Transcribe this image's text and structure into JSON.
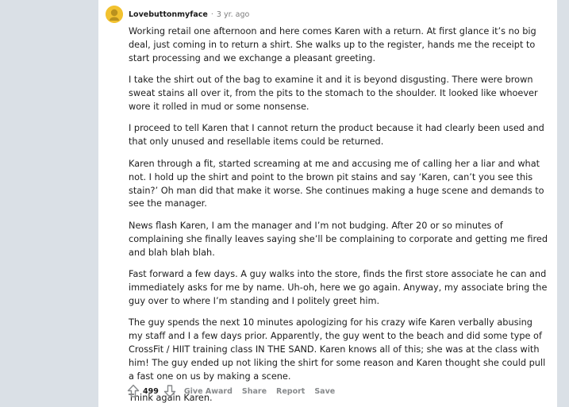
{
  "comment": {
    "username": "Lovebuttonmyface",
    "separator": "·",
    "time_ago": "3 yr. ago",
    "paragraphs": [
      "Working retail one afternoon and here comes Karen with a return. At first glance it’s no big deal, just coming in to return a shirt. She walks up to the register, hands me the receipt to start processing and we exchange a pleasant greeting.",
      "I take the shirt out of the bag to examine it and it is beyond disgusting. There were brown sweat stains all over it, from the pits to the stomach to the shoulder. It looked like whoever wore it rolled in mud or some nonsense.",
      "I proceed to tell Karen that I cannot return the product because it had clearly been used and that only unused and resellable items could be returned.",
      "Karen through a fit, started screaming at me and accusing me of calling her a liar and what not. I hold up the shirt and point to the brown pit stains and say ‘Karen, can’t you see this stain?’ Oh man did that make it worse. She continues making a huge scene and demands to see the manager.",
      "News flash Karen, I am the manager and I’m not budging. After 20 or so minutes of complaining she finally leaves saying she’ll be complaining to corporate and getting me fired and blah blah blah.",
      "Fast forward a few days. A guy walks into the store, finds the first store associate he can and immediately asks for me by name. Uh-oh, here we go again. Anyway, my associate bring the guy over to where I’m standing and I politely greet him.",
      "The guy spends the next 10 minutes apologizing for his crazy wife Karen verbally abusing my staff and I a few days prior. Apparently, the guy went to the beach and did some type of CrossFit / HIIT training class IN THE SAND. Karen knows all of this; she was at the class with him! The guy ended up not liking the shirt for some reason and Karen thought she could pull a fast one on us by making a scene.",
      "Think again Karen."
    ],
    "score": "499",
    "actions": {
      "give_award": "Give Award",
      "share": "Share",
      "report": "Report",
      "save": "Save"
    }
  },
  "colors": {
    "page_background": "#dae0e6",
    "card_background": "#ffffff",
    "text": "#1c1c1c",
    "meta_text": "#7c7c7c",
    "action_text": "#878a8c",
    "avatar": "#f2c230"
  },
  "icons": {
    "upvote": "upvote-arrow-icon",
    "downvote": "downvote-arrow-icon",
    "avatar": "snoo-avatar-icon"
  }
}
